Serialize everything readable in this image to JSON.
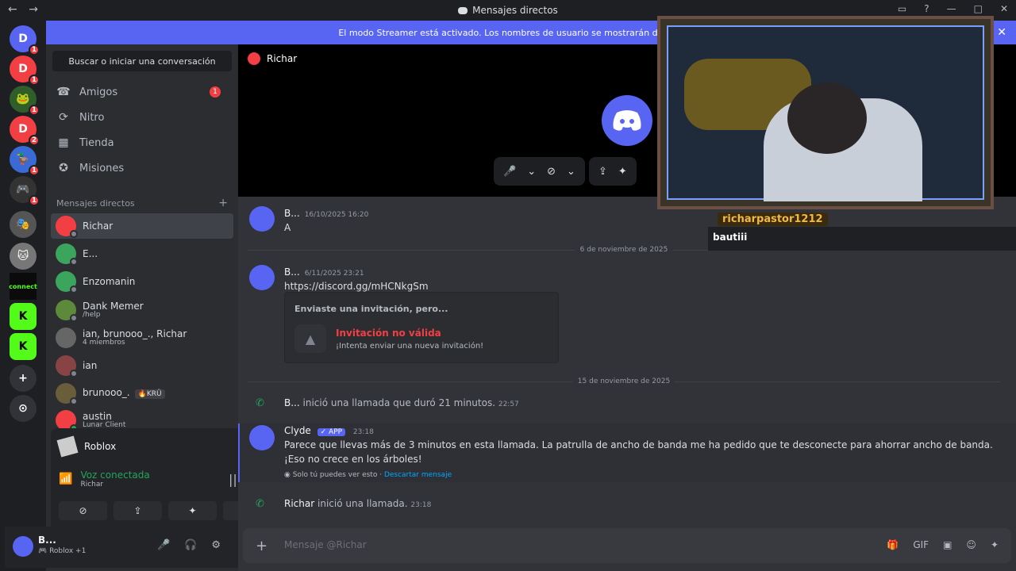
{
  "window": {
    "title": "Mensajes directos",
    "nav_back": "←",
    "nav_fwd": "→",
    "controls": [
      "▭",
      "?",
      "—",
      "□",
      "✕"
    ]
  },
  "servers": [
    {
      "label": "D",
      "color": "#5865f2",
      "badge": "1"
    },
    {
      "label": "D",
      "color": "#f23f43",
      "badge": "1"
    },
    {
      "label": "🐸",
      "color": "#2f5e2a",
      "badge": "1"
    },
    {
      "label": "D",
      "color": "#f23f43",
      "badge": "2"
    },
    {
      "label": "🦆",
      "color": "#3a6ad6",
      "badge": "1"
    },
    {
      "label": "🎮",
      "color": "#333",
      "badge": "1"
    },
    {
      "label": "🎭",
      "color": "#555",
      "badge": ""
    },
    {
      "label": "🐱",
      "color": "#777",
      "badge": ""
    },
    {
      "label": "connect",
      "color": "#0b0b0b",
      "badge": ""
    },
    {
      "label": "K",
      "color": "#53fc18",
      "badge": ""
    },
    {
      "label": "K",
      "color": "#53fc18",
      "badge": ""
    },
    {
      "label": "+",
      "color": "#313338",
      "badge": ""
    },
    {
      "label": "⊙",
      "color": "#313338",
      "badge": ""
    }
  ],
  "banner": {
    "text": "El modo Streamer está activado. Los nombres de usuario se mostrarán de forma parcial",
    "close": "✕"
  },
  "sidebar": {
    "search_label": "Buscar o iniciar una conversación",
    "nav": [
      {
        "icon": "☎",
        "label": "Amigos",
        "count": "1"
      },
      {
        "icon": "⟳",
        "label": "Nitro",
        "count": ""
      },
      {
        "icon": "▦",
        "label": "Tienda",
        "count": ""
      },
      {
        "icon": "✪",
        "label": "Misiones",
        "count": ""
      }
    ],
    "dm_header": "Mensajes directos",
    "dm_add": "+",
    "dms": [
      {
        "name": "Richar",
        "sub": "",
        "tag": "",
        "color": "#f23f43",
        "status": "#80848e",
        "active": true
      },
      {
        "name": "E...",
        "sub": "",
        "tag": "",
        "color": "#3ba55d",
        "status": "#80848e"
      },
      {
        "name": "Enzomanin",
        "sub": "",
        "tag": "",
        "color": "#3ba55d",
        "status": "#80848e"
      },
      {
        "name": "Dank Memer",
        "sub": "/help",
        "tag": "",
        "color": "#5d8a3a",
        "status": "#80848e"
      },
      {
        "name": "ian, brunooo_., Richar",
        "sub": "4 miembros",
        "tag": "",
        "color": "#666",
        "status": ""
      },
      {
        "name": "ian",
        "sub": "",
        "tag": "",
        "color": "#884444",
        "status": "#80848e"
      },
      {
        "name": "brunooo_.",
        "sub": "",
        "tag": "🔥KRÜ",
        "color": "#6a5d3a",
        "status": "#80848e"
      },
      {
        "name": "austin",
        "sub": "Lunar Client",
        "tag": "",
        "color": "#f23f43",
        "status": "#23a55a"
      }
    ]
  },
  "panel": {
    "activity": "Roblox",
    "voice_status": "Voz conectada",
    "voice_channel": "Richar",
    "buttons": [
      "⊘",
      "⇪",
      "✦",
      "🚀"
    ]
  },
  "user": {
    "name": "B...",
    "status": "🎮 Roblox +1",
    "icons": [
      "🎤",
      "🎧",
      "⚙"
    ]
  },
  "call": {
    "header_name": "Richar",
    "controls_a": [
      "🎤",
      "⌄",
      "⊘",
      "⌄"
    ],
    "controls_b": [
      "⇪",
      "✦"
    ]
  },
  "messages": {
    "m1": {
      "author": "B...",
      "time": "16/10/2025 16:20",
      "text": "A"
    },
    "div1": "6 de noviembre de 2025",
    "m2": {
      "author": "B...",
      "time": "6/11/2025 23:21",
      "link": "https://discord.gg/mHCNkgSm"
    },
    "invite": {
      "heading": "Enviaste una invitación, pero...",
      "title": "Invitación no válida",
      "subtitle": "¡Intenta enviar una nueva invitación!"
    },
    "div2": "15 de noviembre de 2025",
    "sys1": {
      "author": "B...",
      "text": "inició una llamada que duró 21 minutos.",
      "time": "22:57"
    },
    "clyde": {
      "author": "Clyde",
      "tag": "✓ APP",
      "time": "23:18",
      "text": "Parece que llevas más de 3 minutos en esta llamada. La patrulla de ancho de banda me ha pedido que te desconecte para ahorrar ancho de banda. ¡Eso no crece en los árboles!",
      "note": "Solo tú puedes ver esto",
      "dismiss": "Descartar mensaje"
    },
    "sys2": {
      "author": "Richar",
      "text": "inició una llamada.",
      "time": "23:18"
    }
  },
  "composer": {
    "placeholder": "Mensaje @Richar",
    "plus": "+",
    "icons": [
      "🎁",
      "GIF",
      "▣",
      "☺",
      "✦"
    ]
  },
  "overlay": {
    "username": "richarpastor1212",
    "message": "bautiii"
  }
}
